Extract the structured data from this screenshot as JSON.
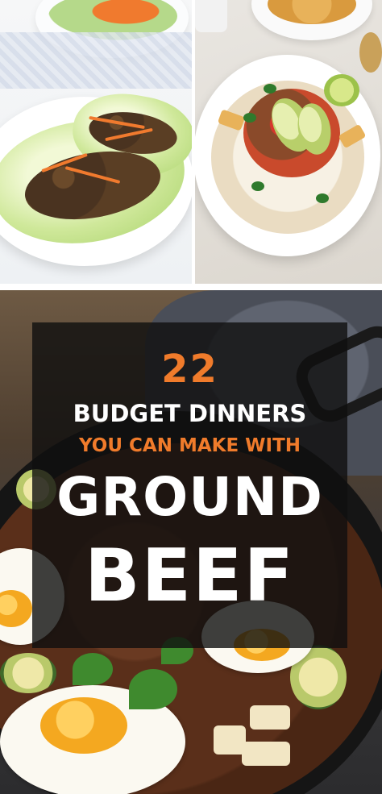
{
  "photos": {
    "top_left": {
      "icon": "lettuce-wraps-photo"
    },
    "top_right": {
      "icon": "taco-bowl-photo"
    },
    "bottom": {
      "icon": "ground-beef-skillet-photo"
    }
  },
  "overlay": {
    "number": "22",
    "line1": "BUDGET DINNERS",
    "line2": "YOU CAN MAKE WITH",
    "line3": "GROUND",
    "line4": "BEEF"
  },
  "colors": {
    "accent": "#f07b2b",
    "overlay_bg": "#0f0f0f",
    "text": "#ffffff"
  }
}
